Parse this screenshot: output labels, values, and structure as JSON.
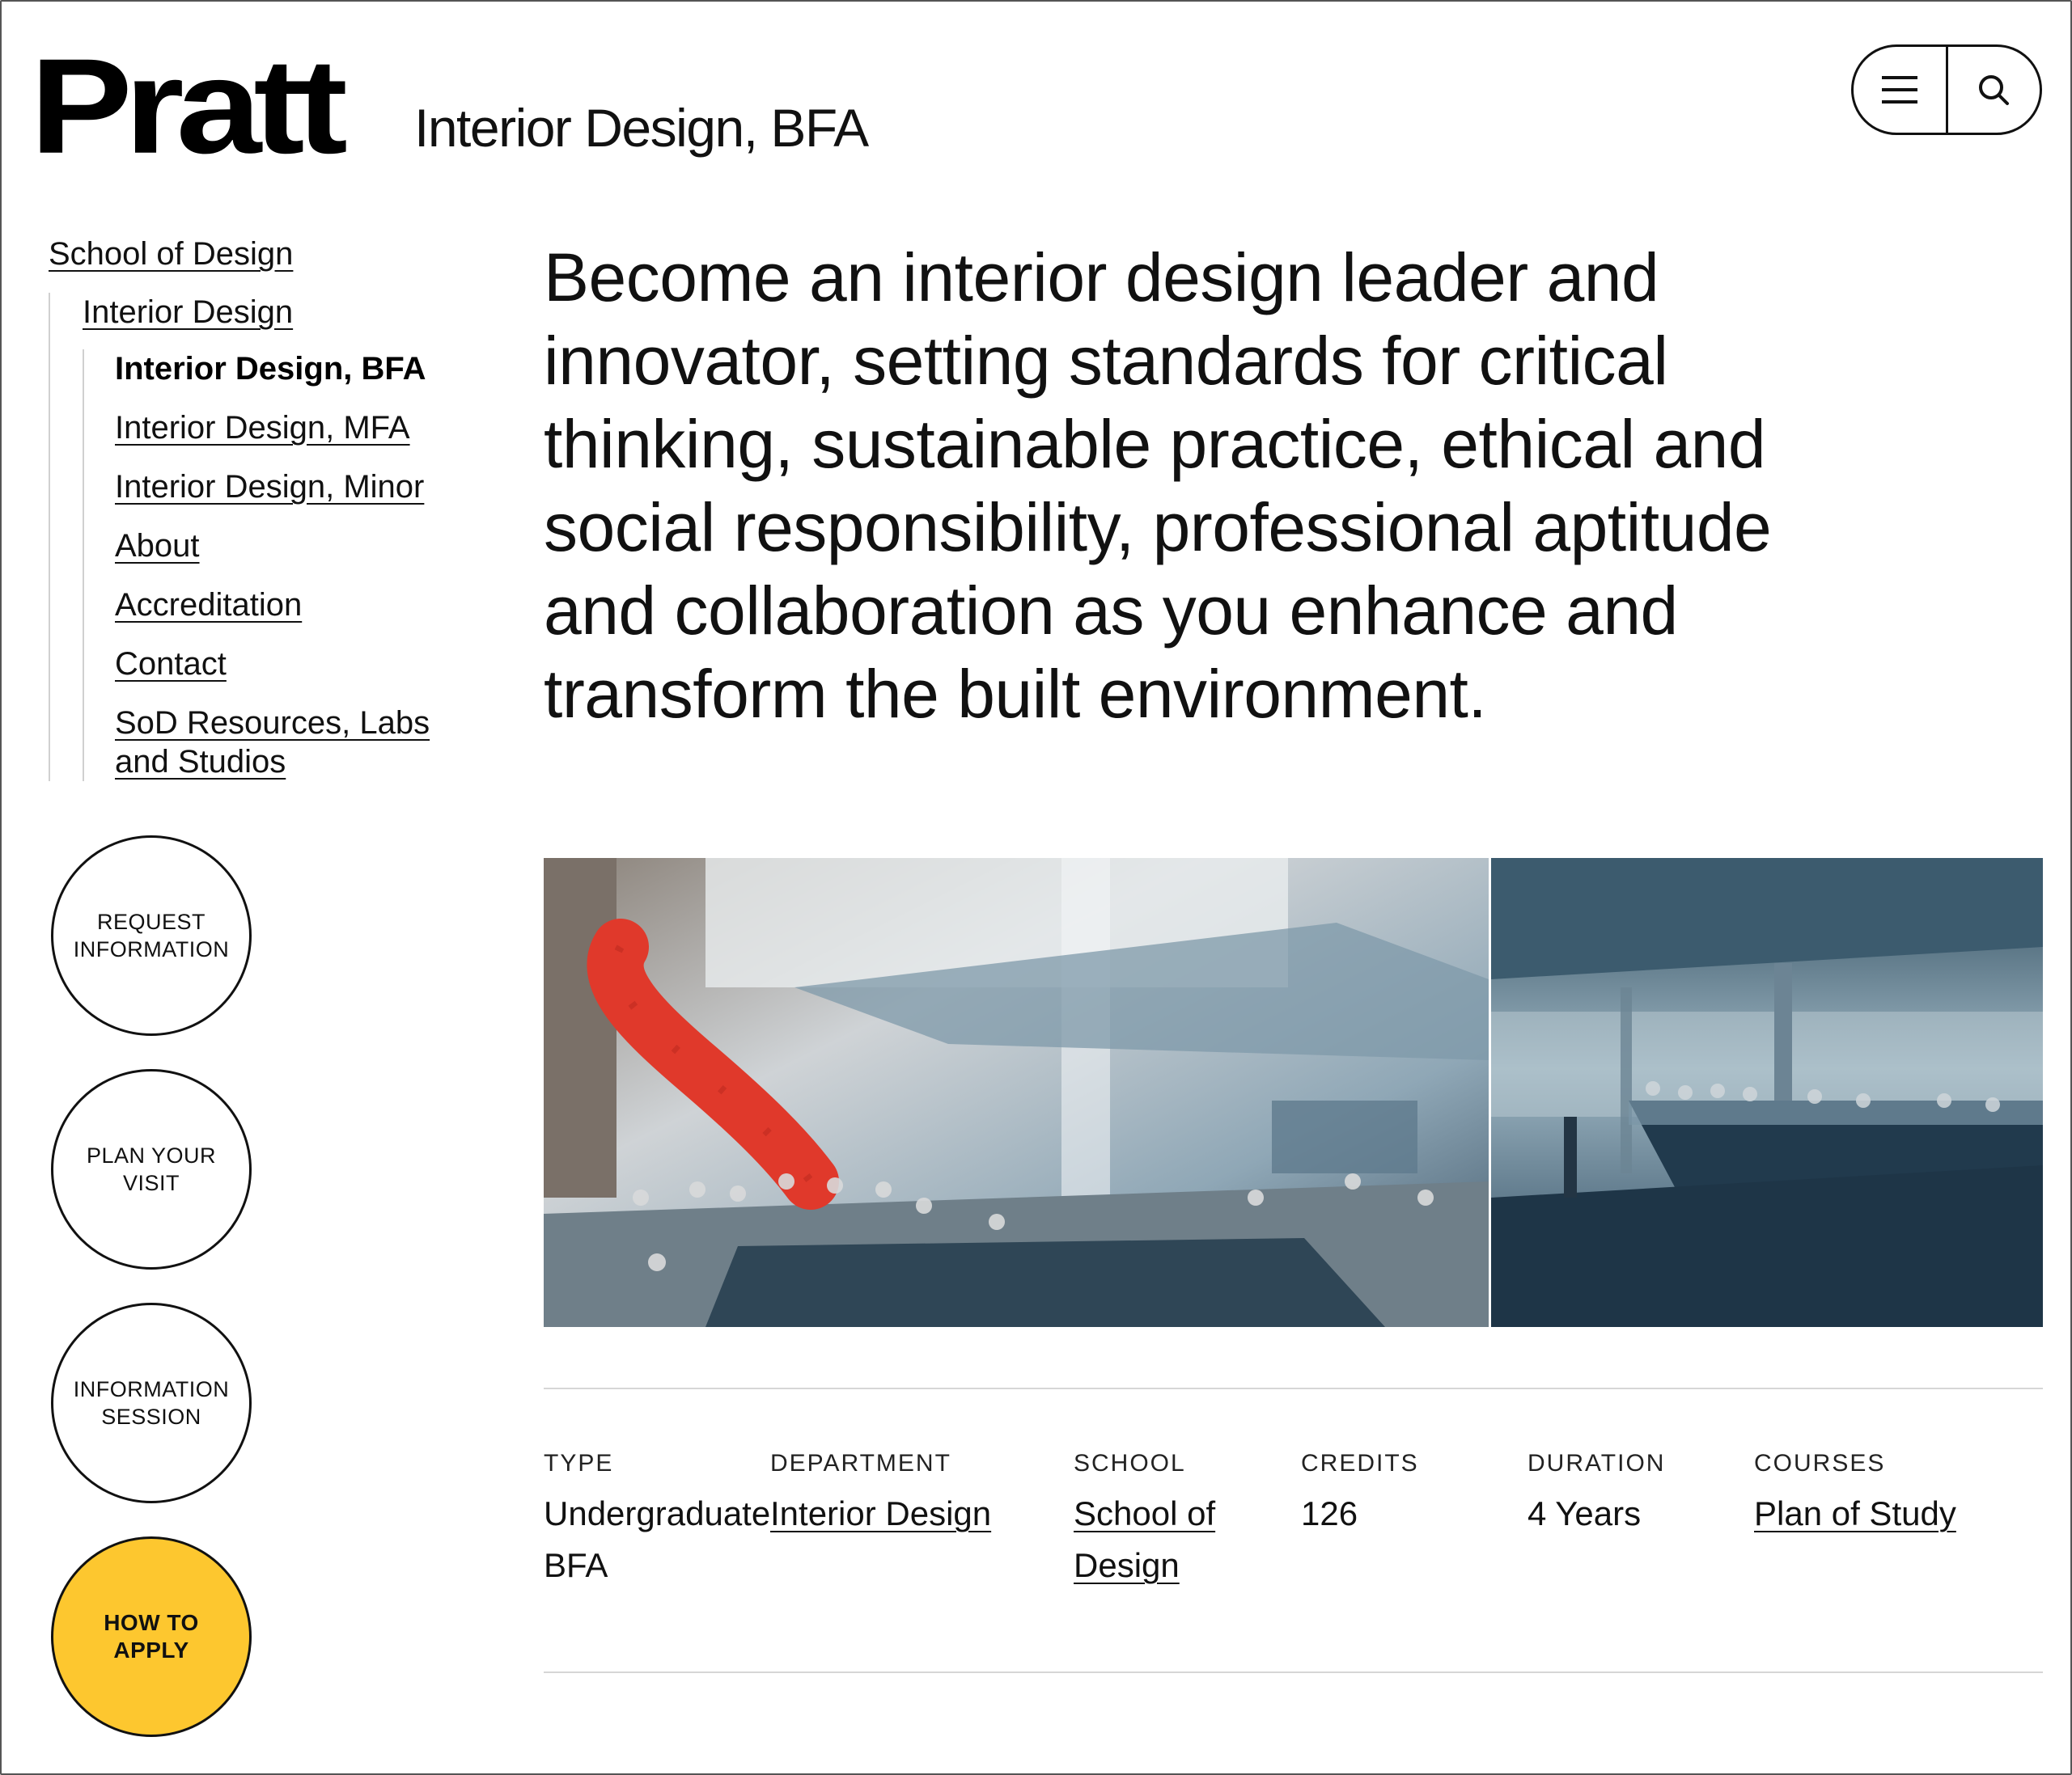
{
  "brand": {
    "logo_text": "Pratt"
  },
  "header": {
    "program_title": "Interior Design, BFA"
  },
  "controls": {
    "menu_icon": "hamburger-menu-icon",
    "search_icon": "search-icon"
  },
  "sidenav": {
    "school": "School of Design",
    "department": "Interior Design",
    "current": "Interior Design, BFA",
    "items": [
      "Interior Design, MFA",
      "Interior Design, Minor",
      "About",
      "Accreditation",
      "Contact",
      "SoD Resources, Labs and Studios"
    ]
  },
  "ctas": {
    "request": "REQUEST INFORMATION",
    "visit": "PLAN YOUR VISIT",
    "session": "INFORMATION SESSION",
    "apply": "HOW TO APPLY",
    "apply_color": "#fdc72f"
  },
  "hero": {
    "statement": "Become an interior design leader and innovator, setting standards for critical thinking, sustainable practice, ethical and social responsibility, professional aptitude and collaboration as you enhance and transform the built environment."
  },
  "meta": {
    "type_label": "TYPE",
    "type_value_1": "Undergraduate",
    "type_value_2": "BFA",
    "department_label": "DEPARTMENT",
    "department_value": "Interior Design",
    "school_label": "SCHOOL",
    "school_value": "School of Design",
    "credits_label": "CREDITS",
    "credits_value": "126",
    "duration_label": "DURATION",
    "duration_value": "4 Years",
    "courses_label": "COURSES",
    "courses_value": "Plan of Study"
  }
}
